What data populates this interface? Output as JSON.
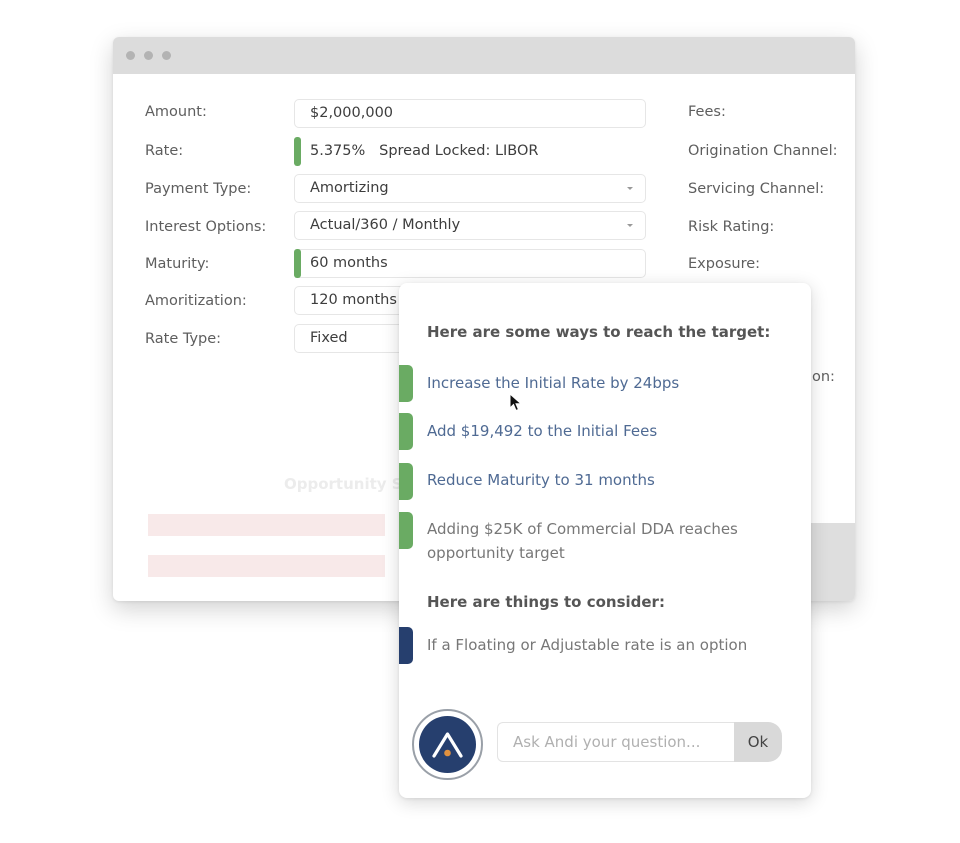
{
  "window": {
    "controls": [
      "close",
      "minimize",
      "maximize"
    ]
  },
  "form": {
    "left": [
      {
        "label": "Amount:",
        "value": "$2,000,000",
        "type": "input",
        "marked": false
      },
      {
        "label": "Rate:",
        "value": "5.375%   Spread Locked: LIBOR",
        "type": "readonly",
        "marked": true
      },
      {
        "label": "Payment Type:",
        "value": "Amortizing",
        "type": "select",
        "marked": false
      },
      {
        "label": "Interest Options:",
        "value": "Actual/360 / Monthly",
        "type": "select",
        "marked": false
      },
      {
        "label": "Maturity:",
        "value": "60 months",
        "type": "input",
        "marked": true
      },
      {
        "label": "Amoritization:",
        "value": "120 months",
        "type": "input",
        "marked": false
      },
      {
        "label": "Rate Type:",
        "value": "Fixed",
        "type": "input",
        "marked": false
      }
    ],
    "right": [
      {
        "label": "Fees:"
      },
      {
        "label": "Origination Channel:"
      },
      {
        "label": "Servicing Channel:"
      },
      {
        "label": "Risk Rating:"
      },
      {
        "label": "Exposure:"
      },
      {
        "label": "on:"
      }
    ]
  },
  "opportunity": {
    "title": "Opportunity S"
  },
  "assistant": {
    "heading_target": "Here are some ways to reach the target:",
    "suggestions": [
      {
        "text": "Increase the Initial Rate by 24bps",
        "kind": "link",
        "color": "#6aab63"
      },
      {
        "text": "Add $19,492 to the Initial Fees",
        "kind": "link",
        "color": "#6aab63"
      },
      {
        "text": "Reduce Maturity to 31 months",
        "kind": "link",
        "color": "#6aab63"
      },
      {
        "text": "Adding $25K of Commercial DDA reaches opportunity target",
        "kind": "info",
        "color": "#6aab63"
      }
    ],
    "heading_consider": "Here are things to consider:",
    "considerations": [
      {
        "text": "If a Floating or Adjustable rate is an option",
        "color": "#263f6e"
      }
    ],
    "ask_placeholder": "Ask Andi your question...",
    "ok_label": "Ok",
    "avatar_icon": "andi-logo-icon"
  },
  "colors": {
    "accent_green": "#6aab63",
    "accent_navy": "#263f6e",
    "link": "#4f6a93",
    "avatar_dot": "#e0913f"
  }
}
